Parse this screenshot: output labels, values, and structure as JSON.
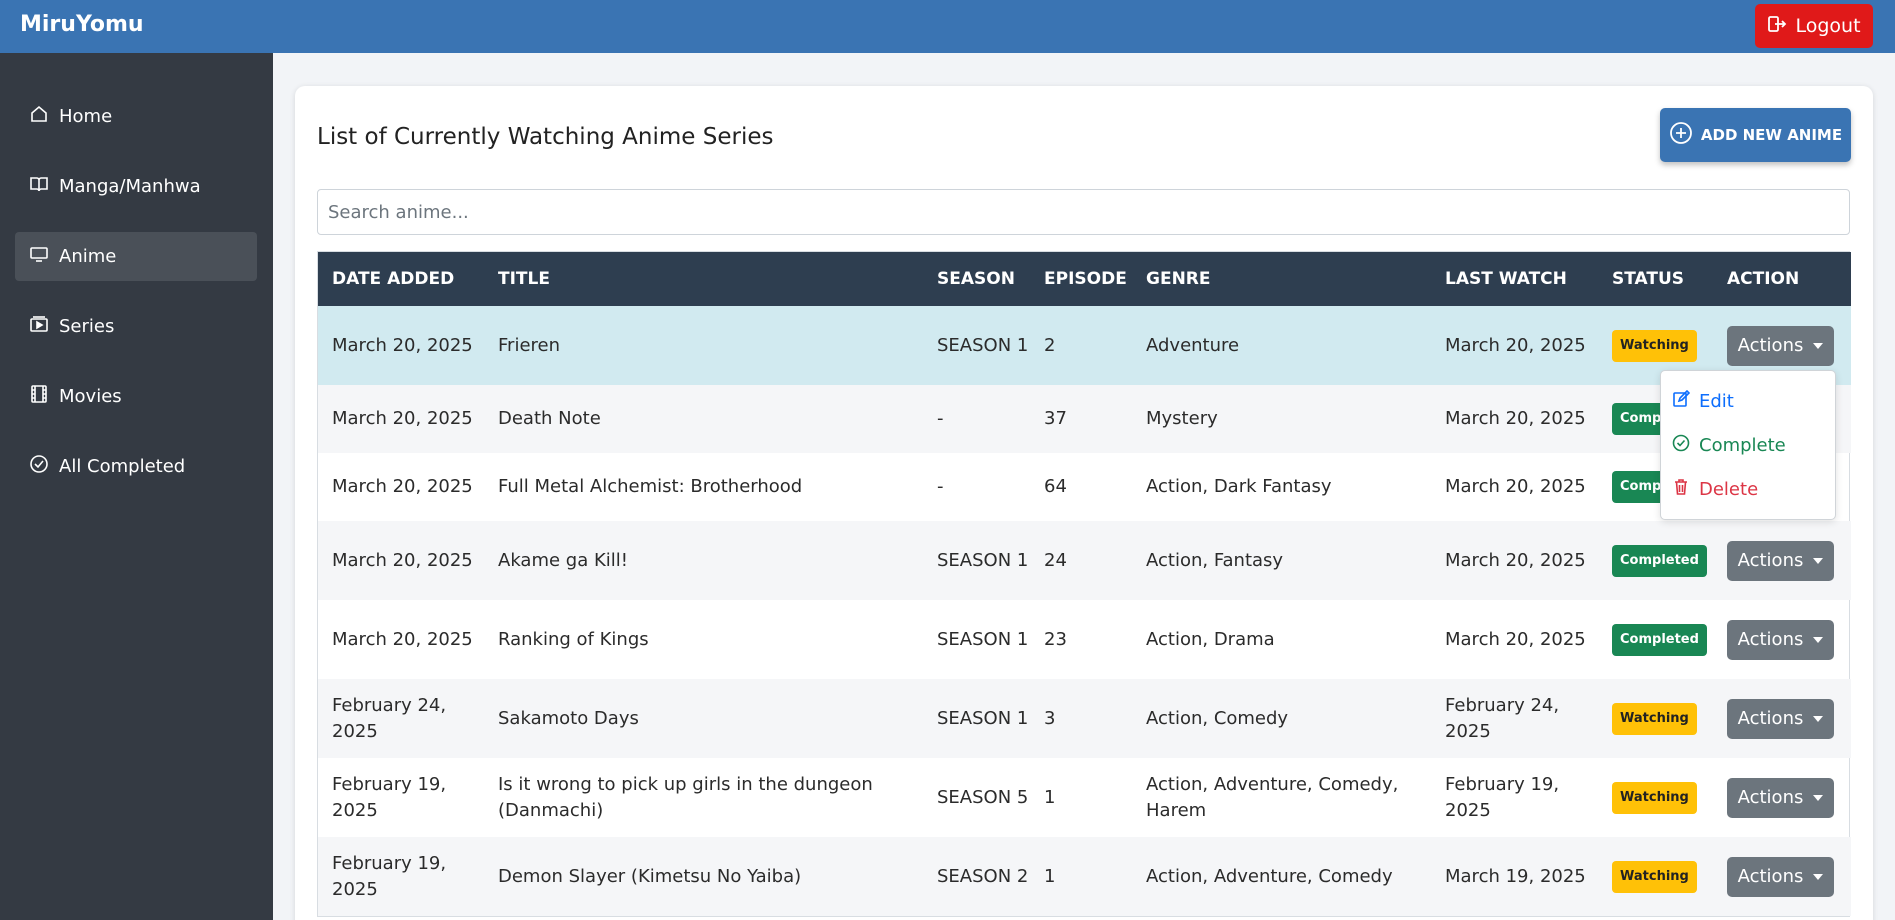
{
  "app": {
    "brand": "MiruYomu",
    "logout_label": "Logout"
  },
  "sidebar": {
    "items": [
      {
        "label": "Home",
        "icon": "home-icon"
      },
      {
        "label": "Manga/Manhwa",
        "icon": "book-icon"
      },
      {
        "label": "Anime",
        "icon": "tv-icon",
        "active": true
      },
      {
        "label": "Series",
        "icon": "play-icon"
      },
      {
        "label": "Movies",
        "icon": "film-icon"
      },
      {
        "label": "All Completed",
        "icon": "check-circle-icon"
      }
    ]
  },
  "main": {
    "title": "List of Currently Watching Anime Series",
    "add_button": "ADD NEW ANIME",
    "search_placeholder": "Search anime...",
    "columns": [
      "DATE ADDED",
      "TITLE",
      "SEASON",
      "EPISODE",
      "GENRE",
      "LAST WATCH",
      "STATUS",
      "ACTION"
    ],
    "rows": [
      {
        "date_added": "March 20, 2025",
        "title": "Frieren",
        "season": "SEASON 1",
        "episode": "2",
        "genre": "Adventure",
        "last_watch": "March 20, 2025",
        "status": "Watching",
        "action": "Actions",
        "highlighted": true
      },
      {
        "date_added": "March 20, 2025",
        "title": "Death Note",
        "season": "-",
        "episode": "37",
        "genre": "Mystery",
        "last_watch": "March 20, 2025",
        "status": "Completed",
        "action": "Actions"
      },
      {
        "date_added": "March 20, 2025",
        "title": "Full Metal Alchemist: Brotherhood",
        "season": "-",
        "episode": "64",
        "genre": "Action, Dark Fantasy",
        "last_watch": "March 20, 2025",
        "status": "Completed",
        "action": "Actions"
      },
      {
        "date_added": "March 20, 2025",
        "title": "Akame ga Kill!",
        "season": "SEASON 1",
        "episode": "24",
        "genre": "Action, Fantasy",
        "last_watch": "March 20, 2025",
        "status": "Completed",
        "action": "Actions"
      },
      {
        "date_added": "March 20, 2025",
        "title": "Ranking of Kings",
        "season": "SEASON 1",
        "episode": "23",
        "genre": "Action, Drama",
        "last_watch": "March 20, 2025",
        "status": "Completed",
        "action": "Actions"
      },
      {
        "date_added": "February 24, 2025",
        "title": "Sakamoto Days",
        "season": "SEASON 1",
        "episode": "3",
        "genre": "Action, Comedy",
        "last_watch": "February 24, 2025",
        "status": "Watching",
        "action": "Actions"
      },
      {
        "date_added": "February 19, 2025",
        "title": "Is it wrong to pick up girls in the dungeon (Danmachi)",
        "season": "SEASON 5",
        "episode": "1",
        "genre": "Action, Adventure, Comedy, Harem",
        "last_watch": "February 19, 2025",
        "status": "Watching",
        "action": "Actions"
      },
      {
        "date_added": "February 19, 2025",
        "title": "Demon Slayer (Kimetsu No Yaiba)",
        "season": "SEASON 2",
        "episode": "1",
        "genre": "Action, Adventure, Comedy",
        "last_watch": "March 19, 2025",
        "status": "Watching",
        "action": "Actions"
      }
    ]
  },
  "dropdown": {
    "edit": "Edit",
    "complete": "Complete",
    "delete": "Delete"
  },
  "colors": {
    "topbar": "#3a74b3",
    "sidebar": "#343a43",
    "logout": "#e01919",
    "table_header": "#2e3e50",
    "watching": "#ffc107",
    "completed": "#198754"
  }
}
